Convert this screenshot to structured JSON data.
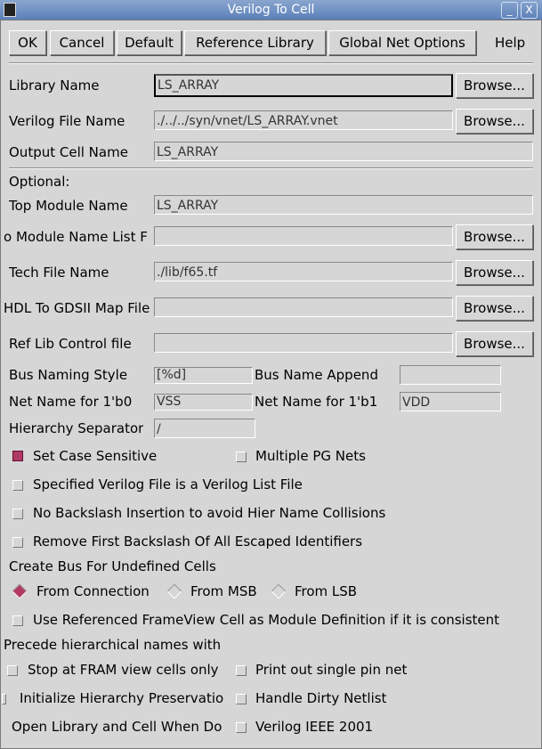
{
  "window": {
    "title": "Verilog To Cell",
    "minimize": "_",
    "close": "X"
  },
  "toolbar": {
    "ok": "OK",
    "cancel": "Cancel",
    "default": "Default",
    "reference_library": "Reference Library",
    "global_net_options": "Global Net Options",
    "help": "Help"
  },
  "browse_label": "Browse...",
  "fields": {
    "library_name": {
      "label": "Library Name",
      "value": "LS_ARRAY"
    },
    "verilog_file_name": {
      "label": "Verilog File Name",
      "value": "./../../syn/vnet/LS_ARRAY.vnet"
    },
    "output_cell_name": {
      "label": "Output Cell Name",
      "value": "LS_ARRAY"
    },
    "optional": "Optional:",
    "top_module_name": {
      "label": "Top Module Name",
      "value": "LS_ARRAY"
    },
    "module_name_list": {
      "label": "o Module Name List F",
      "value": ""
    },
    "tech_file_name": {
      "label": "Tech File Name",
      "value": "./lib/f65.tf"
    },
    "hdl_gdsii_map": {
      "label": "HDL To GDSII Map File",
      "value": ""
    },
    "ref_lib_control": {
      "label": "Ref Lib Control file",
      "value": ""
    },
    "bus_naming_style": {
      "label": "Bus Naming Style",
      "value": "[%d]"
    },
    "bus_name_append": {
      "label": "Bus Name Append",
      "value": ""
    },
    "net_1b0": {
      "label": "Net Name for 1'b0",
      "value": "VSS"
    },
    "net_1b1": {
      "label": "Net Name for 1'b1",
      "value": "VDD"
    },
    "hier_sep": {
      "label": "Hierarchy Separator",
      "value": "/"
    }
  },
  "options": {
    "set_case_sensitive": {
      "label": "Set Case Sensitive",
      "checked": true
    },
    "multiple_pg_nets": {
      "label": "Multiple PG Nets",
      "checked": false
    },
    "verilog_list_file": {
      "label": "Specified Verilog File is a Verilog List File",
      "checked": false
    },
    "no_backslash": {
      "label": "No Backslash Insertion to avoid Hier Name Collisions",
      "checked": false
    },
    "remove_backslash": {
      "label": "Remove First Backslash Of All Escaped Identifiers",
      "checked": false
    },
    "create_bus_label": "Create Bus For Undefined Cells",
    "bus_radios": [
      {
        "label": "From Connection",
        "selected": true
      },
      {
        "label": "From MSB",
        "selected": false
      },
      {
        "label": "From LSB",
        "selected": false
      }
    ],
    "use_frameview": {
      "label": "Use Referenced FrameView Cell as Module Definition if it is consistent",
      "checked": false
    },
    "precede_label": "Precede hierarchical names with",
    "stop_fram": {
      "label": "Stop at FRAM view cells only",
      "checked": false
    },
    "print_single_pin": {
      "label": "Print out single pin net",
      "checked": false
    },
    "init_hier": {
      "label": "Initialize Hierarchy Preservatio",
      "checked": false
    },
    "handle_dirty": {
      "label": "Handle Dirty Netlist",
      "checked": false
    },
    "open_library": {
      "label": "Open Library and Cell When Do",
      "checked": false
    },
    "verilog_ieee": {
      "label": "Verilog IEEE 2001",
      "checked": false
    }
  },
  "colors": {
    "accent": "#b03a64",
    "title_bar": "#6b8cc0"
  }
}
